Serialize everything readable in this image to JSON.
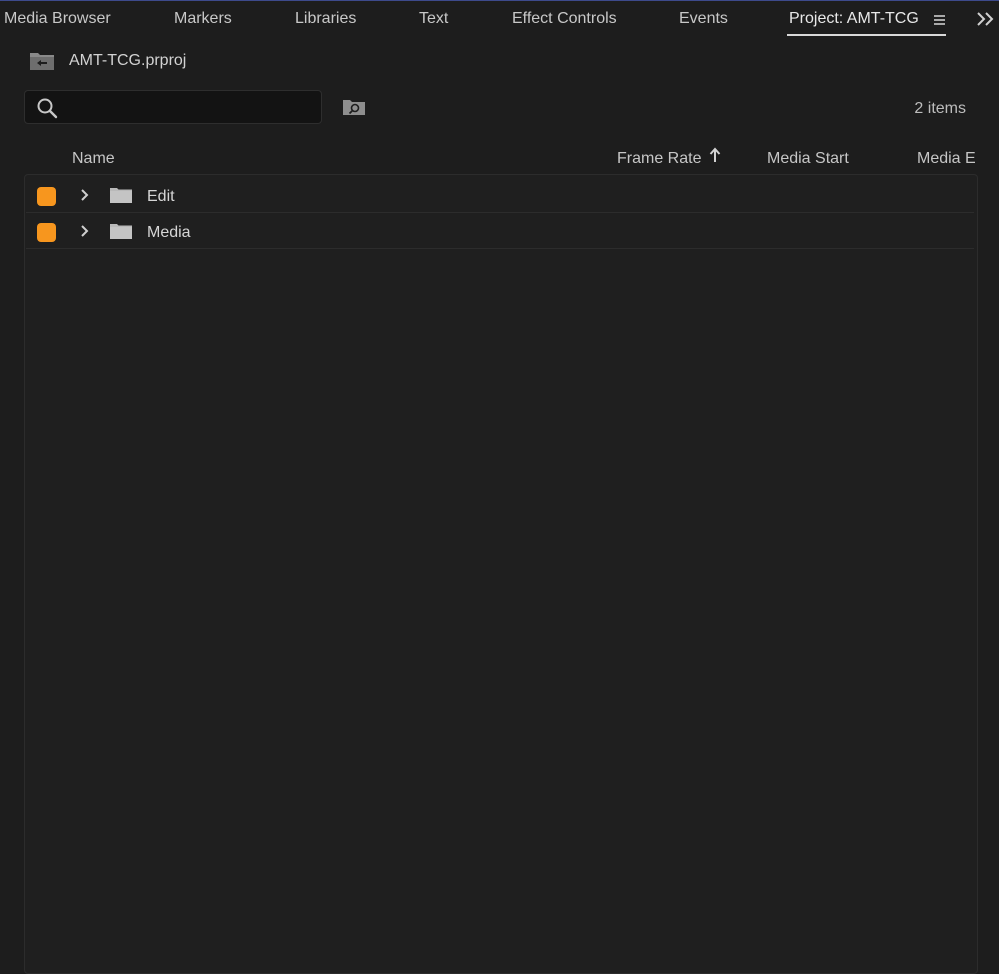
{
  "tabs": [
    {
      "label": "Media Browser"
    },
    {
      "label": "Markers"
    },
    {
      "label": "Libraries"
    },
    {
      "label": "Text"
    },
    {
      "label": "Effect Controls"
    },
    {
      "label": "Events"
    },
    {
      "label": "Project: AMT-TCG",
      "active": true
    }
  ],
  "project": {
    "file_name": "AMT-TCG.prproj"
  },
  "search": {
    "value": "",
    "placeholder": ""
  },
  "item_count": "2 items",
  "columns": {
    "name": "Name",
    "frame_rate": "Frame Rate",
    "media_start": "Media Start",
    "media_end": "Media E"
  },
  "sort": {
    "column": "Frame Rate",
    "direction": "ascending"
  },
  "items": [
    {
      "name": "Edit",
      "type": "folder",
      "label_color": "#f7961e",
      "expanded": false
    },
    {
      "name": "Media",
      "type": "folder",
      "label_color": "#f7961e",
      "expanded": false
    }
  ],
  "icons": {
    "menu": "hamburger-menu-icon",
    "overflow": "double-chevron-right-icon",
    "project": "project-folder-icon",
    "search": "search-icon",
    "find": "find-in-folder-icon",
    "sort": "sort-ascending-arrow-icon",
    "expand": "chevron-right-icon",
    "folder": "folder-icon"
  },
  "colors": {
    "background": "#1d1d1d",
    "label_orange": "#f7961e",
    "tab_accent": "#3d4a8c"
  }
}
